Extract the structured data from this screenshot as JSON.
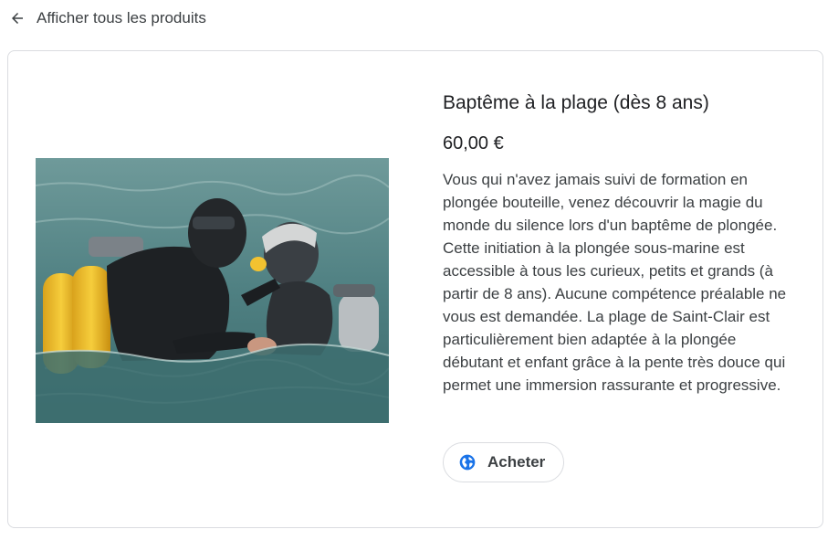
{
  "nav": {
    "back_label": "Afficher tous les produits",
    "back_icon": "arrow-back-icon"
  },
  "product": {
    "title": "Baptême à la plage (dès 8 ans)",
    "price": "60,00 €",
    "description": "Vous qui n'avez jamais suivi de formation en plongée bouteille, venez découvrir la magie du monde du silence lors d'un baptême de plongée. Cette initiation à la plongée sous-marine est accessible à tous les curieux, petits et grands (à partir de 8 ans). Aucune compétence préalable ne vous est demandée. La plage de Saint-Clair est particulièrement bien adaptée à la plongée débutant et enfant grâce à la pente très douce qui permet une immersion rassurante et progressive.",
    "buy_label": "Acheter",
    "buy_icon": "globe-icon",
    "image_icon": "scuba-divers-photo"
  },
  "colors": {
    "accent": "#1a73e8",
    "border": "#dadce0",
    "text": "#202124"
  }
}
